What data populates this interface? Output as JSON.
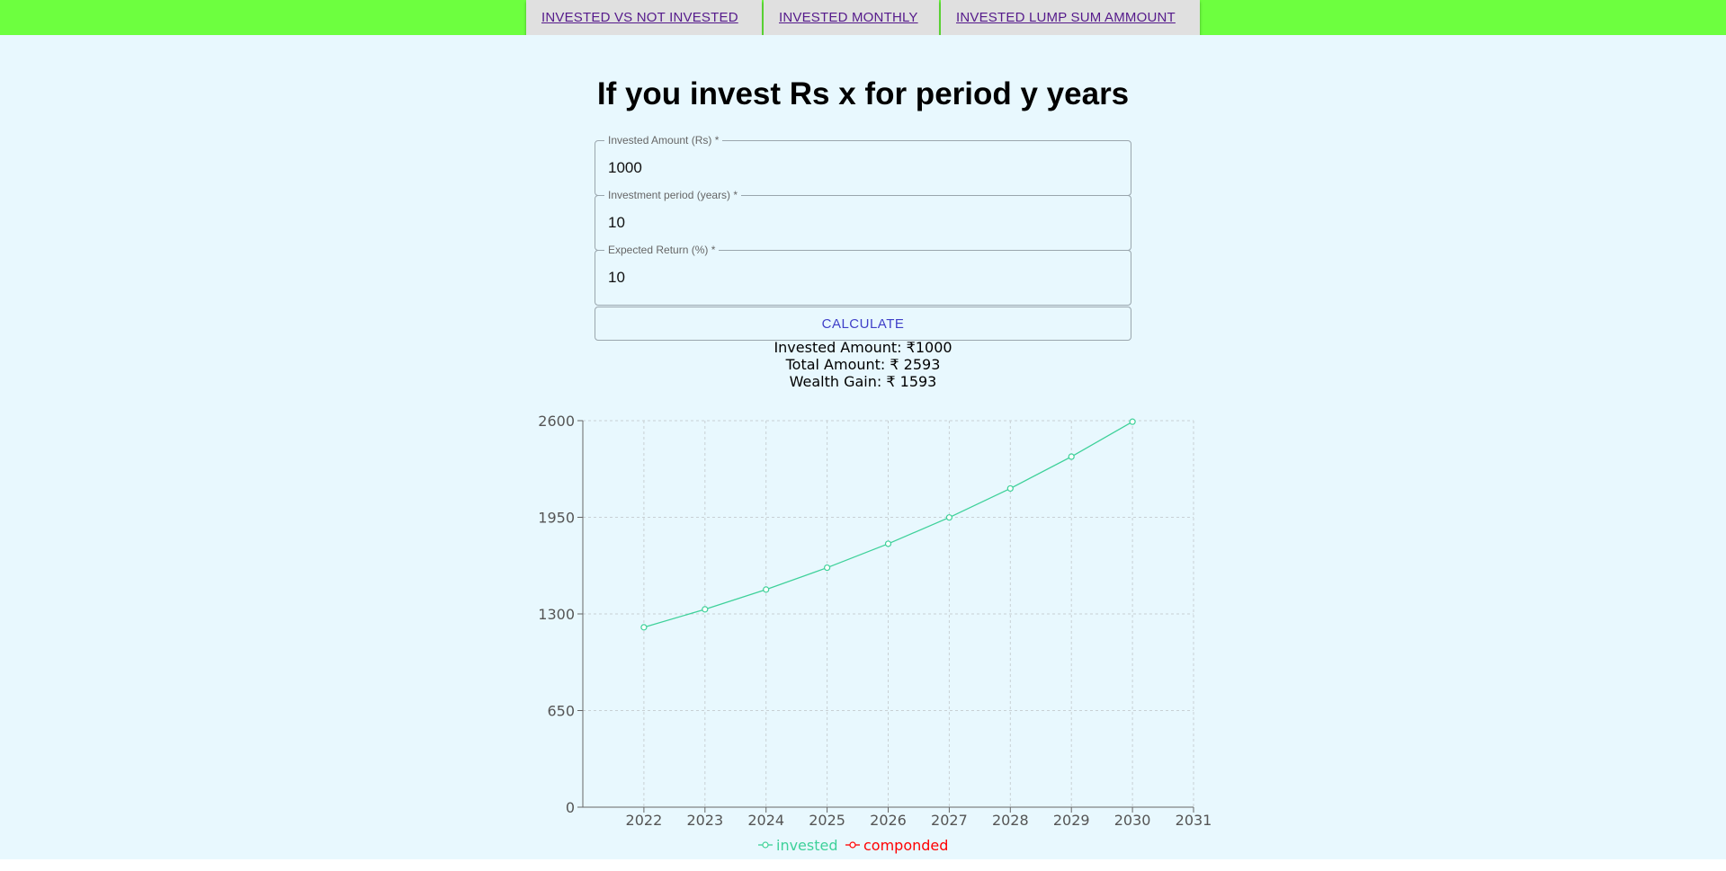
{
  "nav": {
    "tabs": [
      {
        "label": "INVESTED VS NOT INVESTED"
      },
      {
        "label": "INVESTED MONTHLY"
      },
      {
        "label": "INVESTED LUMP SUM AMMOUNT"
      }
    ]
  },
  "page": {
    "title": "If you invest Rs x for period y years"
  },
  "form": {
    "amount": {
      "label": "Invested Amount (Rs) *",
      "value": "1000"
    },
    "period": {
      "label": "Investment period (years) *",
      "value": "10"
    },
    "return": {
      "label": "Expected Return (%) *",
      "value": "10"
    },
    "calculate_label": "CALCULATE"
  },
  "results": {
    "invested": "Invested Amount: ₹1000",
    "total": "Total Amount: ₹ 2593",
    "gain": "Wealth Gain: ₹ 1593"
  },
  "colors": {
    "topbar": "#6dff3f",
    "background": "#e8f8fe",
    "invested_series": "#3ed19a",
    "componded_series": "#ff0000"
  },
  "chart_data": {
    "type": "line",
    "x": [
      2022,
      2023,
      2024,
      2025,
      2026,
      2027,
      2028,
      2029,
      2030
    ],
    "x_ticks": [
      2022,
      2023,
      2024,
      2025,
      2026,
      2027,
      2028,
      2029,
      2030,
      2031
    ],
    "y_ticks": [
      0,
      650,
      1300,
      1950,
      2600
    ],
    "xlim": [
      2021,
      2031
    ],
    "ylim": [
      0,
      2600
    ],
    "grid": true,
    "legend_position": "bottom",
    "series": [
      {
        "name": "invested",
        "values": [
          1210,
          1331,
          1464,
          1611,
          1772,
          1949,
          2144,
          2358,
          2593
        ]
      },
      {
        "name": "componded",
        "values": []
      }
    ]
  }
}
